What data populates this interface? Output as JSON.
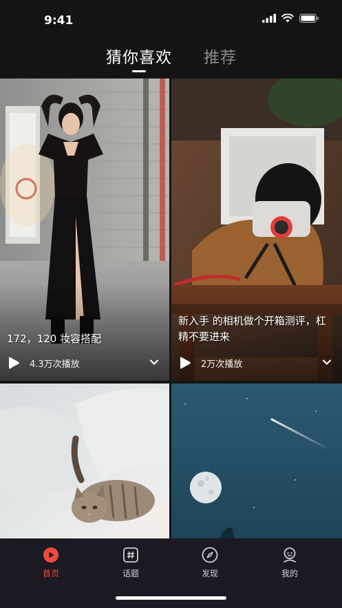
{
  "status_bar": {
    "time": "9:41"
  },
  "tabs": {
    "active": "猜你喜欢",
    "inactive": "推荐"
  },
  "cards": [
    {
      "caption": "172，120 妆容搭配",
      "plays": "4.3万次播放"
    },
    {
      "caption": "新入手 的相机做个开箱测评，杠精不要进来",
      "plays": "2万次播放"
    }
  ],
  "tabbar": {
    "items": [
      {
        "label": "首页",
        "icon": "play-circle-icon",
        "active": true
      },
      {
        "label": "话题",
        "icon": "hashtag-icon",
        "active": false
      },
      {
        "label": "发现",
        "icon": "compass-icon",
        "active": false
      },
      {
        "label": "我的",
        "icon": "user-icon",
        "active": false
      }
    ]
  },
  "colors": {
    "background": "#141414",
    "accent": "#EF4B3A",
    "tabbar": "#1B1A22"
  }
}
